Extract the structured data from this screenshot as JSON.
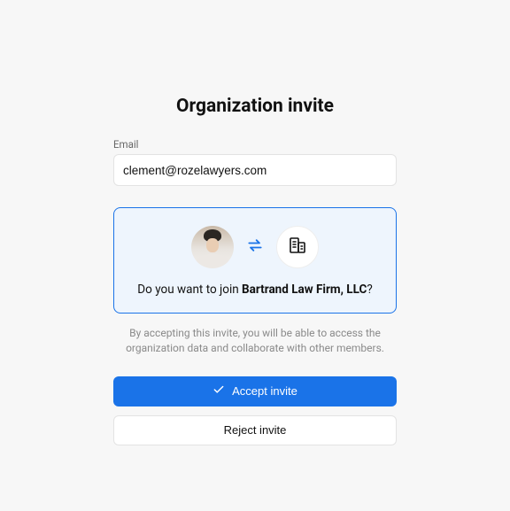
{
  "title": "Organization invite",
  "email": {
    "label": "Email",
    "value": "clement@rozelawyers.com"
  },
  "invite": {
    "prompt_prefix": "Do you want to join ",
    "org_name": "Bartrand Law Firm, LLC",
    "prompt_suffix": "?",
    "helper": "By accepting this invite, you will be able to access the organization data and collaborate with other members."
  },
  "actions": {
    "accept_label": "Accept invite",
    "reject_label": "Reject invite"
  },
  "colors": {
    "accent": "#1a73e8"
  }
}
